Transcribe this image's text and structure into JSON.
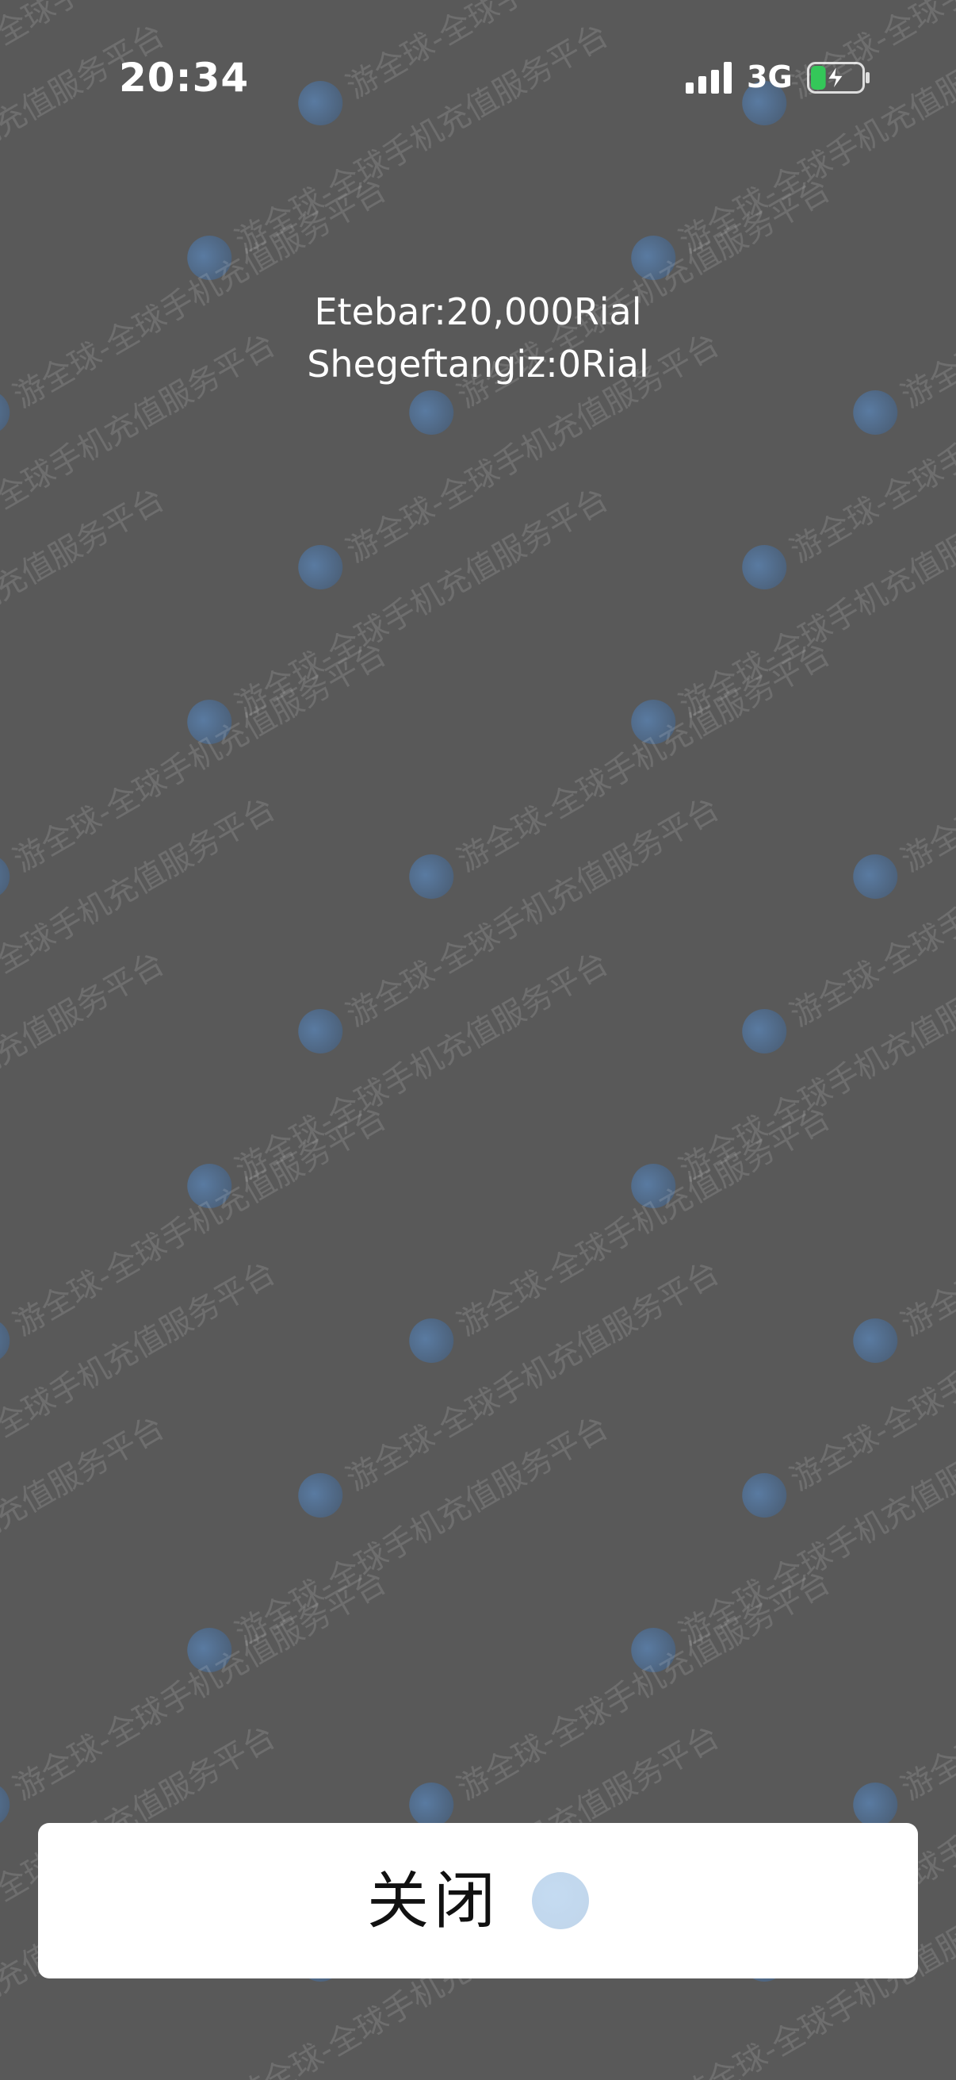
{
  "status_bar": {
    "time": "20:34",
    "network": "3G",
    "battery_charging": true,
    "battery_level": 0.3
  },
  "balance": {
    "credit_line": "Etebar:20,000Rial",
    "gift_line": "Shegeftangiz:0Rial"
  },
  "watermark": {
    "text": "游全球-全球手机充值服务平台"
  },
  "actions": {
    "close_label": "关闭"
  },
  "colors": {
    "background": "#595959",
    "button_bg": "#ffffff",
    "battery_fill": "#34c759"
  }
}
